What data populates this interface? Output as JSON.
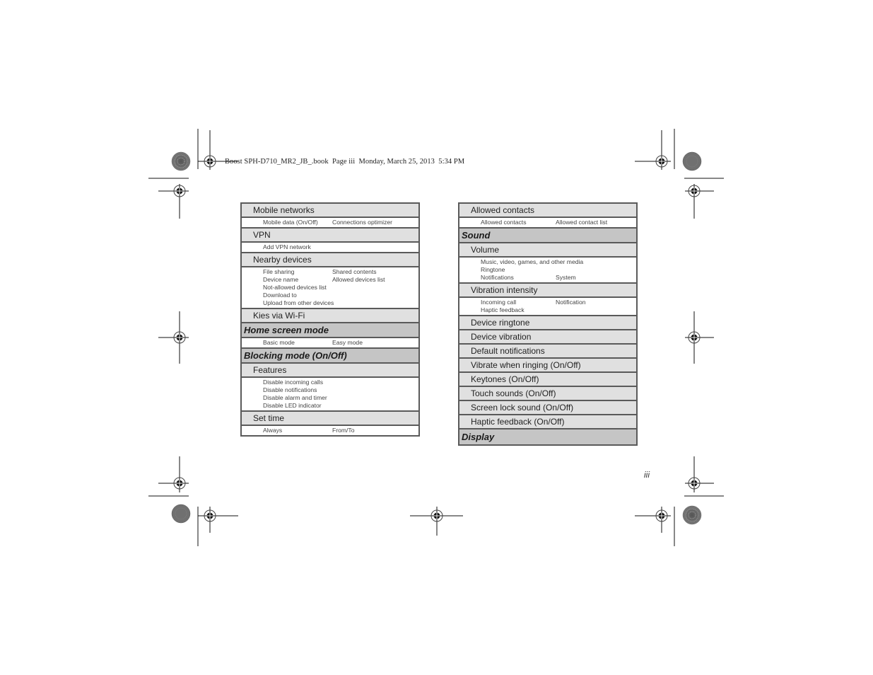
{
  "header": {
    "slug": "Boost SPH-D710_MR2_JB_.book  Page iii  Monday, March 25, 2013  5:34 PM"
  },
  "page_number": "iii",
  "left_table": {
    "rows": [
      {
        "type": "sub",
        "label": "Mobile networks"
      },
      {
        "type": "items",
        "cols": 2,
        "items": [
          "Mobile data  (On/Off)",
          "Connections optimizer"
        ]
      },
      {
        "type": "sub",
        "label": "VPN"
      },
      {
        "type": "items",
        "cols": 2,
        "items": [
          "Add VPN network"
        ]
      },
      {
        "type": "sub",
        "label": "Nearby devices"
      },
      {
        "type": "items",
        "cols": 2,
        "items": [
          "File sharing",
          "Shared contents",
          "Device name",
          "Allowed devices list",
          "Not-allowed devices list",
          "",
          "Download to",
          "",
          "Upload from other devices",
          ""
        ]
      },
      {
        "type": "sub",
        "label": "Kies via Wi-Fi"
      },
      {
        "type": "section",
        "label": "Home screen mode"
      },
      {
        "type": "items",
        "cols": 2,
        "items": [
          "Basic mode",
          "Easy mode"
        ]
      },
      {
        "type": "section",
        "label": "Blocking mode (On/Off)"
      },
      {
        "type": "sub",
        "label": "Features"
      },
      {
        "type": "items",
        "cols": 2,
        "items": [
          "Disable incoming calls",
          "",
          "Disable notifications",
          "",
          "Disable alarm and timer",
          "",
          "Disable LED indicator",
          ""
        ]
      },
      {
        "type": "sub",
        "label": "Set time"
      },
      {
        "type": "items",
        "cols": 2,
        "items": [
          "Always",
          "From/To"
        ]
      }
    ]
  },
  "right_table": {
    "rows": [
      {
        "type": "sub",
        "label": "Allowed contacts"
      },
      {
        "type": "items",
        "cols": 2,
        "items": [
          "Allowed contacts",
          "Allowed contact list"
        ]
      },
      {
        "type": "section",
        "label": "Sound"
      },
      {
        "type": "sub",
        "label": "Volume"
      },
      {
        "type": "items",
        "cols": 2,
        "items": [
          "Music, video, games, and other media",
          "",
          "Ringtone",
          "",
          "Notifications",
          "System"
        ]
      },
      {
        "type": "sub",
        "label": "Vibration intensity"
      },
      {
        "type": "items",
        "cols": 2,
        "items": [
          "Incoming call",
          "Notification",
          "Haptic feedback",
          ""
        ]
      },
      {
        "type": "sub",
        "label": "Device ringtone"
      },
      {
        "type": "sub",
        "label": "Device vibration"
      },
      {
        "type": "sub",
        "label": "Default notifications"
      },
      {
        "type": "sub",
        "label": "Vibrate when ringing (On/Off)"
      },
      {
        "type": "sub",
        "label": "Keytones  (On/Off)"
      },
      {
        "type": "sub",
        "label": "Touch sounds (On/Off)"
      },
      {
        "type": "sub",
        "label": "Screen lock sound (On/Off)"
      },
      {
        "type": "sub",
        "label": "Haptic feedback (On/Off)"
      },
      {
        "type": "section",
        "label": "Display"
      }
    ]
  }
}
